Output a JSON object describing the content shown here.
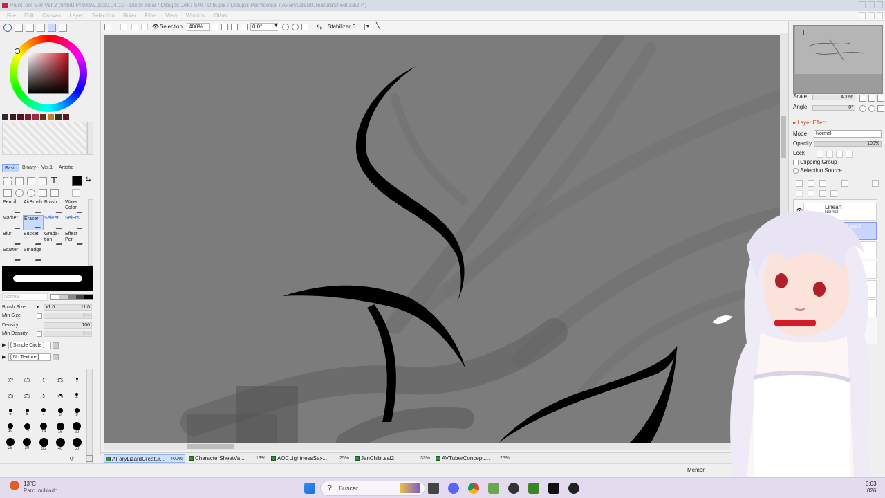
{
  "window": {
    "title": "PaintTool SAI Ver.2 (64bit) Preview.2020.04.10 - Disco local / Dibujos JAKI SAI / Dibujos / Dibujos Paintoolsai / AFaryLizardCreatureSheet.sai2 (*)"
  },
  "menu": [
    "File",
    "Edit",
    "Canvas",
    "Layer",
    "Selection",
    "Ruler",
    "Filter",
    "View",
    "Window",
    "Other"
  ],
  "toolbar": {
    "selection_label": "Selection",
    "zoom": "400%",
    "rotation": "0.0°",
    "stabilizer_label": "Stabilizer",
    "stabilizer_value": "3"
  },
  "tool_tabs": [
    "Basic",
    "Binary",
    "Ver.1",
    "Artistic"
  ],
  "tools": [
    {
      "label": "Pencil",
      "selected": false
    },
    {
      "label": "AirBrush",
      "selected": false
    },
    {
      "label": "Brush",
      "selected": false
    },
    {
      "label": "Water Color",
      "selected": false
    },
    {
      "label": "Marker",
      "selected": false
    },
    {
      "label": "Eraser",
      "selected": true
    },
    {
      "label": "SelPen",
      "selected": false
    },
    {
      "label": "SelErs",
      "selected": false
    },
    {
      "label": "Blur",
      "selected": false
    },
    {
      "label": "Bucket",
      "selected": false
    },
    {
      "label": "Grada-tion",
      "selected": false
    },
    {
      "label": "Effect Pen",
      "selected": false
    },
    {
      "label": "Scatter",
      "selected": false
    },
    {
      "label": "Smudge",
      "selected": false
    }
  ],
  "brush": {
    "blend_mode": "Normal",
    "size_label": "Brush Size",
    "size_multiplier": "x1.0",
    "size_value": "11.0",
    "min_size_label": "Min Size",
    "min_size_value": "0%",
    "density_label": "Density",
    "density_value": "100",
    "min_density_label": "Min Density",
    "min_density_value": "0%",
    "shape": "[ Simple Circle ]",
    "texture": "[ No Texture ]"
  },
  "brush_sizes": [
    "0.7",
    "0.8",
    "1",
    "1.5",
    "2",
    "2.3",
    "2.6",
    "3",
    "3.5",
    "4",
    "5",
    "6",
    "7",
    "8",
    "9",
    "10",
    "12",
    "14",
    "16",
    "20",
    "25",
    "30",
    "35",
    "40",
    "50"
  ],
  "swatch_colors": [
    "#2b2b2b",
    "#3a1a1a",
    "#5a1020",
    "#7a1a2a",
    "#9a2a4a",
    "#6a3010",
    "#c08030",
    "#3a2a20",
    "#5a1a1a"
  ],
  "navigator": {
    "scale_label": "Scale",
    "scale_value": "400%",
    "angle_label": "Angle",
    "angle_value": "0°"
  },
  "layer_panel": {
    "effect_label": "Layer Effect",
    "mode_label": "Mode",
    "mode_value": "Normal",
    "opacity_label": "Opacity",
    "opacity_value": "100%",
    "lock_label": "Lock",
    "clipping_label": "Clipping Group",
    "selection_source_label": "Selection Source",
    "layers": [
      {
        "name": "Lineart",
        "mode": "Normal",
        "selected": false
      },
      {
        "name": "Layer5",
        "mode": "",
        "selected": true
      }
    ]
  },
  "documents": [
    {
      "name": "AFaryLizardCreatur...",
      "zoom": "400%",
      "active": true
    },
    {
      "name": "CharacterSheetVa...",
      "zoom": "13%",
      "active": false
    },
    {
      "name": "AOCLightnessSex...",
      "zoom": "25%",
      "active": false
    },
    {
      "name": "JanChibi.sai2",
      "zoom": "33%",
      "active": false
    },
    {
      "name": "AVTuberConcept....",
      "zoom": "25%",
      "active": false
    }
  ],
  "status": {
    "memory_label": "Memor"
  },
  "taskbar": {
    "weather_temp": "13°C",
    "weather_desc": "Parc. nublado",
    "search_placeholder": "Buscar",
    "clock_time": "0:03",
    "clock_date": "026"
  },
  "colors": {
    "canvas_bg": "#7c7c7c",
    "accent_selected": "#c8dbff",
    "layer_effect_label": "#c24a1a"
  }
}
